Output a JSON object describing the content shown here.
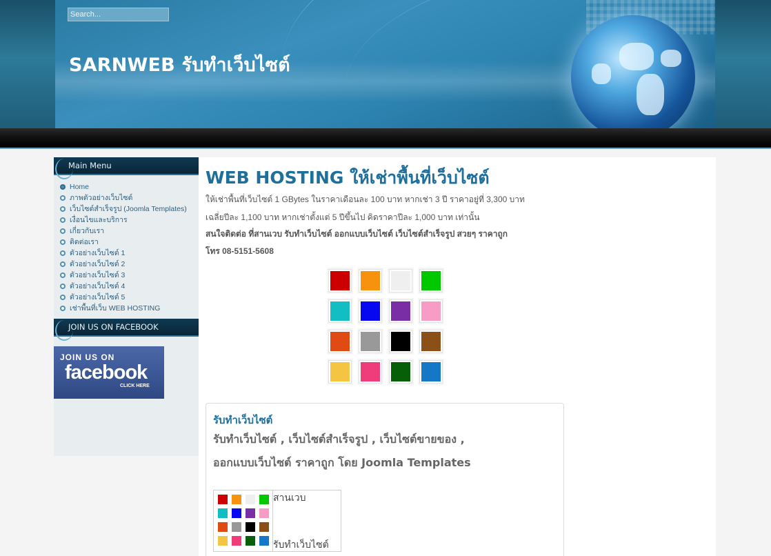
{
  "header": {
    "search_placeholder": "Search...",
    "site_title": "SARNWEB รับทำเว็บไซต์"
  },
  "sidebar": {
    "main_menu_title": "Main Menu",
    "items": [
      {
        "label": "Home",
        "active": true
      },
      {
        "label": "ภาพตัวอย่างเว็บไซต์"
      },
      {
        "label": "เว็บไซต์สำเร็จรูป (Joomla Templates)"
      },
      {
        "label": "เงื่อนไขและบริการ"
      },
      {
        "label": "เกี่ยวกับเรา"
      },
      {
        "label": "ติดต่อเรา"
      },
      {
        "label": "ตัวอย่างเว็บไซต์ 1"
      },
      {
        "label": "ตัวอย่างเว็บไซต์ 2"
      },
      {
        "label": "ตัวอย่างเว็บไซต์ 3"
      },
      {
        "label": "ตัวอย่างเว็บไซต์ 4"
      },
      {
        "label": "ตัวอย่างเว็บไซต์ 5"
      },
      {
        "label": "เช่าพื้นที่เว็บ WEB HOSTING"
      }
    ],
    "facebook_title": "JOIN US ON FACEBOOK",
    "facebook_banner": {
      "join": "JOIN US ON",
      "brand": "facebook",
      "click": "CLICK HERE"
    }
  },
  "main": {
    "title": "WEB HOSTING ให้เช่าพื้นที่เว็บไซต์",
    "line1": "ให้เช่าพื้นที่เว็บไซต์ 1 GBytes ในราคาเดือนละ 100 บาท หากเช่า 3 ปี ราคาอยู่ที่ 3,300 บาท",
    "line2": "เฉลี่ยปีละ 1,100 บาท หากเช่าตั้งแต่ 5 ปีขึ้นไป คิดราคาปีละ 1,000 บาท เท่านั้น",
    "line3": "สนใจติดต่อ ที่สานเวบ รับทำเว็บไซต์ ออกแบบเว็บไซต์ เว็บไซต์สำเร็จรูป สวยๆ ราคาถูก",
    "line4": "โทร 08-5151-5608",
    "swatch_colors": [
      "#cc0000",
      "#f7920f",
      "#efefef",
      "#00c800",
      "#13bdc4",
      "#0808f0",
      "#7a2ea6",
      "#f79cc4",
      "#e04a13",
      "#999999",
      "#000000",
      "#8a5017",
      "#f4c542",
      "#ef3d7c",
      "#075f08",
      "#1478c6"
    ],
    "article": {
      "title": "รับทำเว็บไซต์",
      "sub1": "รับทำเว็บไซต์ , เว็บไซต์สำเร็จรูป , เว็บไซต์ขายของ ,",
      "sub2": "ออกแบบเว็บไซต์ ราคาถูก โดย Joomla Templates",
      "table_text1": "สานเวบ",
      "table_text2": "รับทำเว็บไซต์"
    }
  }
}
